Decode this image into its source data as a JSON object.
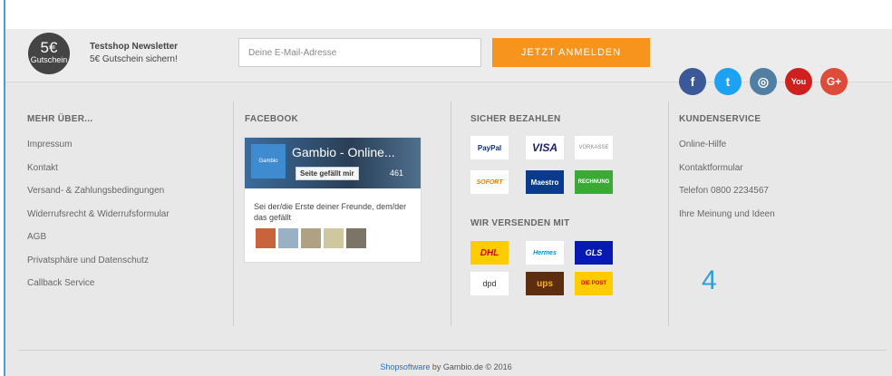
{
  "newsletter": {
    "badge_amount": "5€",
    "badge_label": "Gutschein",
    "title": "Testshop Newsletter",
    "subtitle": "5€ Gutschein sichern!",
    "email_placeholder": "Deine E-Mail-Adresse",
    "subscribe_label": "JETZT ANMELDEN"
  },
  "social": [
    "facebook-icon",
    "twitter-icon",
    "instagram-icon",
    "youtube-icon",
    "google-plus-icon"
  ],
  "social_glyphs": [
    "f",
    "t",
    "◎",
    "You",
    "G+"
  ],
  "social_colors": [
    "#3b5998",
    "#1da1f2",
    "#517fa4",
    "#cd201f",
    "#dd4b39"
  ],
  "columns": {
    "mehr": {
      "heading": "MEHR ÜBER...",
      "items": [
        "Impressum",
        "Kontakt",
        "Versand- & Zahlungsbedingungen",
        "Widerrufsrecht & Widerrufsformular",
        "AGB",
        "Privatsphäre und Datenschutz",
        "Callback Service"
      ]
    },
    "facebook": {
      "heading": "FACEBOOK",
      "logo_text": "Gambio",
      "page_title": "Gambio - Online...",
      "like_label": "Seite gefällt mir",
      "like_count": "461",
      "friends_text": "Sei der/die Erste deiner Freunde, dem/der das gefällt"
    },
    "payment": {
      "heading": "SICHER BEZAHLEN",
      "methods": [
        "PayPal",
        "VISA",
        "VORKASSE",
        "SOFORT",
        "Maestro",
        "RECHNUNG"
      ],
      "shipping_heading": "WIR VERSENDEN MIT",
      "carriers": [
        "DHL",
        "Hermes",
        "GLS",
        "dpd",
        "ups",
        "DIE POST"
      ]
    },
    "service": {
      "heading": "KUNDENSERVICE",
      "items": [
        "Online-Hilfe",
        "Kontaktformular",
        "Telefon 0800 2234567",
        "Ihre Meinung und Ideen"
      ]
    }
  },
  "annotation": "4",
  "copyright": {
    "link": "Shopsoftware",
    "rest": " by Gambio.de © 2016"
  }
}
